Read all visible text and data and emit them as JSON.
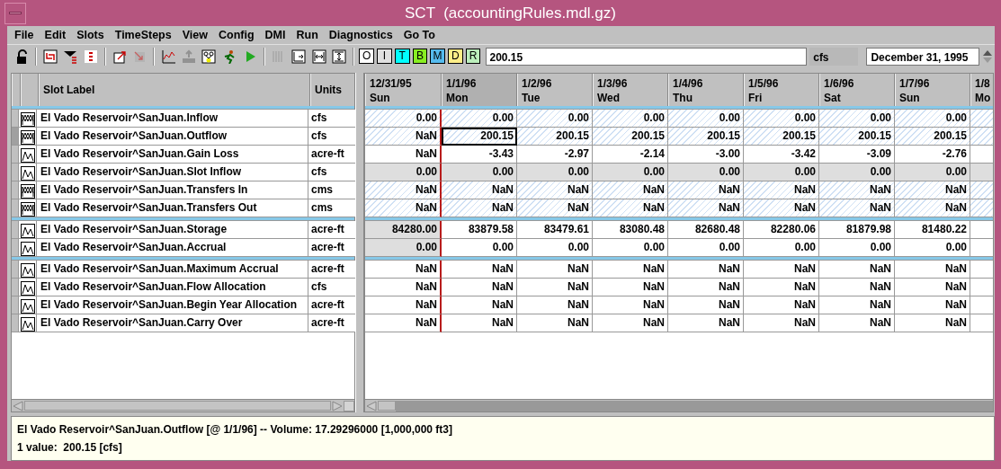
{
  "window": {
    "title": "SCT  (accountingRules.mdl.gz)"
  },
  "menu": [
    "File",
    "Edit",
    "Slots",
    "TimeSteps",
    "View",
    "Config",
    "DMI",
    "Run",
    "Diagnostics",
    "Go To"
  ],
  "toolbar": [
    {
      "disabled": false
    },
    {
      "disabled": false
    },
    {
      "disabled": false
    },
    {
      "disabled": false
    },
    {
      "disabled": false
    },
    {
      "disabled": true
    },
    {
      "disabled": false
    },
    {
      "disabled": true
    },
    {
      "disabled": false
    },
    {
      "disabled": false
    },
    {
      "disabled": false
    },
    {
      "disabled": true
    },
    {
      "disabled": false
    },
    {
      "disabled": false
    },
    {
      "disabled": false
    }
  ],
  "flag_buttons": [
    {
      "label": "O",
      "color": "#ffffff"
    },
    {
      "label": "I",
      "color": "#e0e0e0"
    },
    {
      "label": "T",
      "color": "#00ffff"
    },
    {
      "label": "B",
      "color": "#88ee22"
    },
    {
      "label": "M",
      "color": "#55bbee"
    },
    {
      "label": "D",
      "color": "#ffee88"
    },
    {
      "label": "R",
      "color": "#bbeebb"
    }
  ],
  "value_field": {
    "value": "200.15"
  },
  "units_label": "cfs",
  "date_field": {
    "value": "December 31, 1995"
  },
  "slot_header": {
    "label": "Slot Label",
    "units": "Units"
  },
  "columns": [
    {
      "date": "12/31/95",
      "day": "Sun",
      "kind": "initial",
      "selected": false
    },
    {
      "date": "1/1/96",
      "day": "Mon",
      "kind": "run",
      "selected": true
    },
    {
      "date": "1/2/96",
      "day": "Tue",
      "kind": "run",
      "selected": false
    },
    {
      "date": "1/3/96",
      "day": "Wed",
      "kind": "run",
      "selected": false
    },
    {
      "date": "1/4/96",
      "day": "Thu",
      "kind": "run",
      "selected": false
    },
    {
      "date": "1/5/96",
      "day": "Fri",
      "kind": "run",
      "selected": false
    },
    {
      "date": "1/6/96",
      "day": "Sat",
      "kind": "run",
      "selected": false
    },
    {
      "date": "1/7/96",
      "day": "Sun",
      "kind": "run",
      "selected": false
    },
    {
      "date": "1/8",
      "day": "Mo",
      "kind": "run",
      "selected": false
    }
  ],
  "groups": [
    {
      "rows": [
        {
          "kind": "multi",
          "label": "El Vado Reservoir^SanJuan.Inflow",
          "units": "cfs",
          "input": true,
          "shaded": false,
          "initial_shaded": false,
          "selected": false,
          "values": [
            "0.00",
            "0.00",
            "0.00",
            "0.00",
            "0.00",
            "0.00",
            "0.00",
            "0.00"
          ]
        },
        {
          "kind": "multi",
          "label": "El Vado Reservoir^SanJuan.Outflow",
          "units": "cfs",
          "input": true,
          "shaded": false,
          "initial_shaded": false,
          "selected": true,
          "values": [
            "NaN",
            "200.15",
            "200.15",
            "200.15",
            "200.15",
            "200.15",
            "200.15",
            "200.15"
          ]
        },
        {
          "kind": "single",
          "label": "El Vado Reservoir^SanJuan.Gain Loss",
          "units": "acre-ft",
          "input": false,
          "shaded": false,
          "initial_shaded": false,
          "selected": false,
          "values": [
            "NaN",
            "-3.43",
            "-2.97",
            "-2.14",
            "-3.00",
            "-3.42",
            "-3.09",
            "-2.76"
          ]
        },
        {
          "kind": "single",
          "label": "El Vado Reservoir^SanJuan.Slot Inflow",
          "units": "cfs",
          "input": false,
          "shaded": true,
          "initial_shaded": true,
          "selected": false,
          "values": [
            "0.00",
            "0.00",
            "0.00",
            "0.00",
            "0.00",
            "0.00",
            "0.00",
            "0.00"
          ]
        },
        {
          "kind": "multi",
          "label": "El Vado Reservoir^SanJuan.Transfers In",
          "units": "cms",
          "input": true,
          "shaded": false,
          "initial_shaded": false,
          "selected": false,
          "values": [
            "NaN",
            "NaN",
            "NaN",
            "NaN",
            "NaN",
            "NaN",
            "NaN",
            "NaN"
          ]
        },
        {
          "kind": "multi",
          "label": "El Vado Reservoir^SanJuan.Transfers Out",
          "units": "cms",
          "input": true,
          "shaded": false,
          "initial_shaded": false,
          "selected": false,
          "values": [
            "NaN",
            "NaN",
            "NaN",
            "NaN",
            "NaN",
            "NaN",
            "NaN",
            "NaN"
          ]
        }
      ]
    },
    {
      "rows": [
        {
          "kind": "single",
          "label": "El Vado Reservoir^SanJuan.Storage",
          "units": "acre-ft",
          "input": false,
          "shaded": false,
          "initial_shaded": true,
          "selected": false,
          "values": [
            "84280.00",
            "83879.58",
            "83479.61",
            "83080.48",
            "82680.48",
            "82280.06",
            "81879.98",
            "81480.22"
          ]
        },
        {
          "kind": "single",
          "label": "El Vado Reservoir^SanJuan.Accrual",
          "units": "acre-ft",
          "input": false,
          "shaded": false,
          "initial_shaded": true,
          "selected": false,
          "values": [
            "0.00",
            "0.00",
            "0.00",
            "0.00",
            "0.00",
            "0.00",
            "0.00",
            "0.00"
          ]
        }
      ]
    },
    {
      "rows": [
        {
          "kind": "single",
          "label": "El Vado Reservoir^SanJuan.Maximum Accrual",
          "units": "acre-ft",
          "input": false,
          "shaded": false,
          "initial_shaded": false,
          "selected": false,
          "values": [
            "NaN",
            "NaN",
            "NaN",
            "NaN",
            "NaN",
            "NaN",
            "NaN",
            "NaN"
          ]
        },
        {
          "kind": "single",
          "label": "El Vado Reservoir^SanJuan.Flow Allocation",
          "units": "cfs",
          "input": false,
          "shaded": false,
          "initial_shaded": false,
          "selected": false,
          "values": [
            "NaN",
            "NaN",
            "NaN",
            "NaN",
            "NaN",
            "NaN",
            "NaN",
            "NaN"
          ]
        },
        {
          "kind": "single",
          "label": "El Vado Reservoir^SanJuan.Begin Year Allocation",
          "units": "acre-ft",
          "input": false,
          "shaded": false,
          "initial_shaded": false,
          "selected": false,
          "values": [
            "NaN",
            "NaN",
            "NaN",
            "NaN",
            "NaN",
            "NaN",
            "NaN",
            "NaN"
          ]
        },
        {
          "kind": "single",
          "label": "El Vado Reservoir^SanJuan.Carry Over",
          "units": "acre-ft",
          "input": false,
          "shaded": false,
          "initial_shaded": false,
          "selected": false,
          "values": [
            "NaN",
            "NaN",
            "NaN",
            "NaN",
            "NaN",
            "NaN",
            "NaN",
            "NaN"
          ]
        }
      ]
    }
  ],
  "status_bar": [
    "El Vado Reservoir^SanJuan.Outflow [@ 1/1/96] -- Volume: 17.29296000 [1,000,000 ft3]",
    "1 value:  200.15 [cfs]"
  ]
}
